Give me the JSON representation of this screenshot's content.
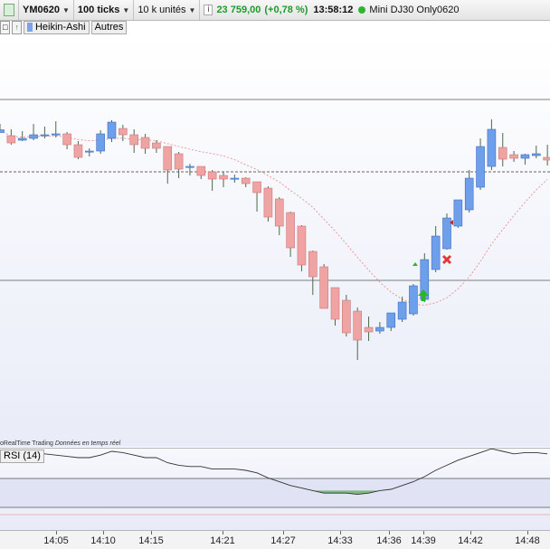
{
  "toolbar": {
    "symbol": "YM0620",
    "ticks": "100 ticks",
    "units": "10 k unités",
    "price": "23 759,00",
    "change": "(+0,78 %)",
    "time": "13:58:12",
    "instrument": "Mini DJ30 Only0620"
  },
  "subbar": {
    "chart_type": "Heikin-Ashi",
    "others": "Autres"
  },
  "watermark": {
    "brand": "oRealTime Trading",
    "realtime": "Données en temps réel"
  },
  "rsi": {
    "label": "RSI (14)"
  },
  "colors": {
    "bull": "#6d9fea",
    "bear": "#f0a3a3",
    "ma": "#e89090",
    "rsi_line": "#333333",
    "rsi_fill": "#7dbb7d"
  },
  "time_labels": [
    "14:05",
    "14:10",
    "14:15",
    "14:21",
    "14:27",
    "14:33",
    "14:36",
    "14:39",
    "14:42",
    "14:48"
  ],
  "candles": [
    {
      "o": 123.5,
      "c": 126.5,
      "h": 133,
      "l": 124
    },
    {
      "o": 120,
      "c": 112,
      "h": 127,
      "l": 110
    },
    {
      "o": 115,
      "c": 117,
      "h": 125,
      "l": 114
    },
    {
      "o": 117,
      "c": 121,
      "h": 133,
      "l": 115
    },
    {
      "o": 121,
      "c": 121,
      "h": 130,
      "l": 117
    },
    {
      "o": 121,
      "c": 122,
      "h": 136,
      "l": 118
    },
    {
      "o": 122,
      "c": 110,
      "h": 124,
      "l": 105
    },
    {
      "o": 110,
      "c": 96,
      "h": 114,
      "l": 94
    },
    {
      "o": 103,
      "c": 103,
      "h": 106,
      "l": 97
    },
    {
      "o": 103,
      "c": 122,
      "h": 126,
      "l": 100
    },
    {
      "o": 117,
      "c": 135,
      "h": 137,
      "l": 113
    },
    {
      "o": 128,
      "c": 121,
      "h": 132,
      "l": 114
    },
    {
      "o": 121,
      "c": 110,
      "h": 127,
      "l": 101
    },
    {
      "o": 118,
      "c": 106,
      "h": 122,
      "l": 100
    },
    {
      "o": 112,
      "c": 106,
      "h": 115,
      "l": 101
    },
    {
      "o": 108,
      "c": 82,
      "h": 108,
      "l": 67
    },
    {
      "o": 100,
      "c": 83,
      "h": 102,
      "l": 73
    },
    {
      "o": 86,
      "c": 86,
      "h": 89,
      "l": 76
    },
    {
      "o": 86,
      "c": 76,
      "h": 86,
      "l": 72
    },
    {
      "o": 80,
      "c": 72,
      "h": 82,
      "l": 59
    },
    {
      "o": 76,
      "c": 72,
      "h": 80,
      "l": 63
    },
    {
      "o": 73,
      "c": 73,
      "h": 77,
      "l": 68
    },
    {
      "o": 73,
      "c": 67,
      "h": 74,
      "l": 63
    },
    {
      "o": 69,
      "c": 57,
      "h": 69,
      "l": 36
    },
    {
      "o": 62,
      "c": 30,
      "h": 64,
      "l": 25
    },
    {
      "o": 50,
      "c": 20,
      "h": 52,
      "l": 10
    },
    {
      "o": 35,
      "c": -4,
      "h": 36,
      "l": -14
    },
    {
      "o": 20,
      "c": -23,
      "h": 21,
      "l": -30
    },
    {
      "o": -8,
      "c": -36,
      "h": -7,
      "l": -56
    },
    {
      "o": -25,
      "c": -71,
      "h": -22,
      "l": -71
    },
    {
      "o": -48,
      "c": -83,
      "h": -48,
      "l": -90
    },
    {
      "o": -62,
      "c": -98,
      "h": -56,
      "l": -102
    },
    {
      "o": -74,
      "c": -106,
      "h": -70,
      "l": -128
    },
    {
      "o": -92,
      "c": -97,
      "h": -80,
      "l": -107
    },
    {
      "o": -96,
      "c": -92,
      "h": -86,
      "l": -99
    },
    {
      "o": -92,
      "c": -76,
      "h": -79,
      "l": -96
    },
    {
      "o": -83,
      "c": -64,
      "h": -58,
      "l": -86
    },
    {
      "o": -77,
      "c": -46,
      "h": -44,
      "l": -79
    },
    {
      "o": -61,
      "c": -17,
      "h": -10,
      "l": -64
    },
    {
      "o": -28,
      "c": 9,
      "h": 20,
      "l": -31
    },
    {
      "o": -5,
      "c": 29,
      "h": 34,
      "l": -6
    },
    {
      "o": 20,
      "c": 49,
      "h": 48,
      "l": 18
    },
    {
      "o": 38,
      "c": 73,
      "h": 82,
      "l": 35
    },
    {
      "o": 63,
      "c": 108,
      "h": 117,
      "l": 60
    },
    {
      "o": 86,
      "c": 127,
      "h": 138,
      "l": 82
    },
    {
      "o": 107,
      "c": 94,
      "h": 123,
      "l": 86
    },
    {
      "o": 99,
      "c": 95,
      "h": 103,
      "l": 91
    },
    {
      "o": 95,
      "c": 99,
      "h": 100,
      "l": 88
    },
    {
      "o": 98,
      "c": 100,
      "h": 109,
      "l": 95
    },
    {
      "o": 96,
      "c": 93,
      "h": 110,
      "l": 87
    }
  ],
  "rsi_values": [
    48,
    50,
    49,
    52,
    53,
    52,
    51,
    50,
    50,
    52,
    55,
    54,
    52,
    50,
    50,
    46,
    44,
    43,
    43,
    41,
    41,
    41,
    40,
    38,
    34,
    31,
    28,
    26,
    24,
    22,
    22,
    22,
    21,
    22,
    24,
    25,
    28,
    31,
    35,
    40,
    44,
    48,
    51,
    54,
    57,
    55,
    53,
    54,
    54,
    53
  ]
}
